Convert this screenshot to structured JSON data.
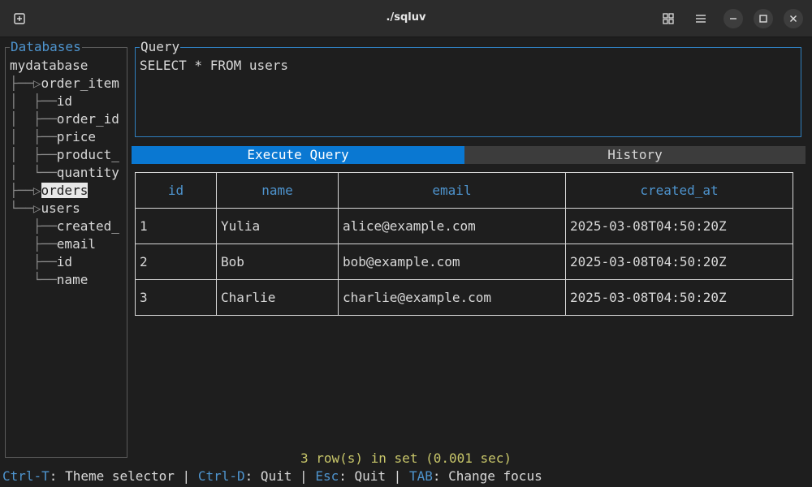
{
  "window": {
    "title": "./sqluv"
  },
  "databases_panel": {
    "title": "Databases",
    "tree": [
      {
        "branch": "",
        "label": "mydatabase",
        "selected": false
      },
      {
        "branch": "├──▷",
        "label": "order_item",
        "selected": false
      },
      {
        "branch": "│  ├──",
        "label": "id",
        "selected": false
      },
      {
        "branch": "│  ├──",
        "label": "order_id",
        "selected": false
      },
      {
        "branch": "│  ├──",
        "label": "price",
        "selected": false
      },
      {
        "branch": "│  ├──",
        "label": "product_",
        "selected": false
      },
      {
        "branch": "│  └──",
        "label": "quantity",
        "selected": false
      },
      {
        "branch": "├──▷",
        "label": "orders",
        "selected": true
      },
      {
        "branch": "└──▷",
        "label": "users",
        "selected": false
      },
      {
        "branch": "   ├──",
        "label": "created_",
        "selected": false
      },
      {
        "branch": "   ├──",
        "label": "email",
        "selected": false
      },
      {
        "branch": "   ├──",
        "label": "id",
        "selected": false
      },
      {
        "branch": "   └──",
        "label": "name",
        "selected": false
      }
    ]
  },
  "query_panel": {
    "title": "Query",
    "text": "SELECT * FROM users"
  },
  "buttons": {
    "execute": "Execute Query",
    "history": "History"
  },
  "results": {
    "columns": [
      "id",
      "name",
      "email",
      "created_at"
    ],
    "rows": [
      [
        "1",
        "Yulia",
        "alice@example.com",
        "2025-03-08T04:50:20Z"
      ],
      [
        "2",
        "Bob",
        "bob@example.com",
        "2025-03-08T04:50:20Z"
      ],
      [
        "3",
        "Charlie",
        "charlie@example.com",
        "2025-03-08T04:50:20Z"
      ]
    ]
  },
  "status": "3 row(s) in set (0.001 sec)",
  "footer": {
    "items": [
      {
        "key": "Ctrl-T",
        "desc": ": Theme selector"
      },
      {
        "key": "Ctrl-D",
        "desc": ": Quit"
      },
      {
        "key": "Esc",
        "desc": ": Quit"
      },
      {
        "key": "TAB",
        "desc": ": Change focus"
      }
    ],
    "separator": " | "
  },
  "icons": {
    "new_tab": "new-tab-icon",
    "grid": "grid-view-icon",
    "menu": "hamburger-menu-icon",
    "minimize": "minimize-icon",
    "maximize": "maximize-icon",
    "close": "close-icon"
  },
  "colors": {
    "accent_blue": "#0a78d2",
    "key_blue": "#4e94ce",
    "status_yellow": "#c9c76a",
    "border_blue": "#2f7fbf"
  }
}
